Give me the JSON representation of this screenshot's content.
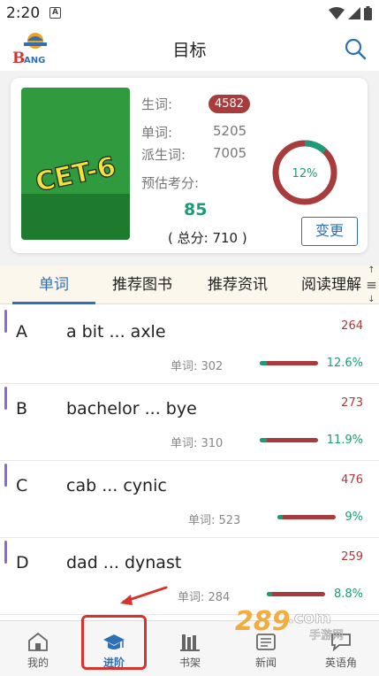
{
  "status_bar": {
    "time": "2:20",
    "notif_letter": "A"
  },
  "header": {
    "title": "目标"
  },
  "goal_card": {
    "cover_text": "CET-6",
    "vocab_label": "生词:",
    "vocab_value": "4582",
    "words_label": "单词:",
    "words_value": "5205",
    "derived_label": "派生词:",
    "derived_value": "7005",
    "estimate_label": "预估考分:",
    "score": "85",
    "total": "( 总分: 710 )",
    "progress_text": "12%",
    "progress": 0.12,
    "change_label": "变更"
  },
  "tabs": [
    {
      "label": "单词"
    },
    {
      "label": "推荐图书"
    },
    {
      "label": "推荐资讯"
    },
    {
      "label": "阅读理解"
    }
  ],
  "tab_menu_glyph": "≡",
  "rows": [
    {
      "letter": "A",
      "range": "a bit ... axle",
      "count": "264",
      "words": "单词: 302",
      "pct_text": "12.6%",
      "progress": 0.126
    },
    {
      "letter": "B",
      "range": "bachelor ... bye",
      "count": "273",
      "words": "单词: 310",
      "pct_text": "11.9%",
      "progress": 0.119
    },
    {
      "letter": "C",
      "range": "cab ... cynic",
      "count": "476",
      "words": "单词: 523",
      "pct_text": "9%",
      "progress": 0.09
    },
    {
      "letter": "D",
      "range": "dad ... dynast",
      "count": "259",
      "words": "单词: 284",
      "pct_text": "8.8%",
      "progress": 0.088
    }
  ],
  "bottom_nav": [
    {
      "label": "我的",
      "icon": "home-icon"
    },
    {
      "label": "进阶",
      "icon": "graduation-cap-icon"
    },
    {
      "label": "书架",
      "icon": "bookshelf-icon"
    },
    {
      "label": "新闻",
      "icon": "news-icon"
    },
    {
      "label": "英语角",
      "icon": "chat-icon"
    }
  ],
  "colors": {
    "accent_blue": "#2f6fb4",
    "progress_green": "#1f9a78",
    "progress_red": "#a83c3c",
    "annotation_red": "#d6332c"
  }
}
